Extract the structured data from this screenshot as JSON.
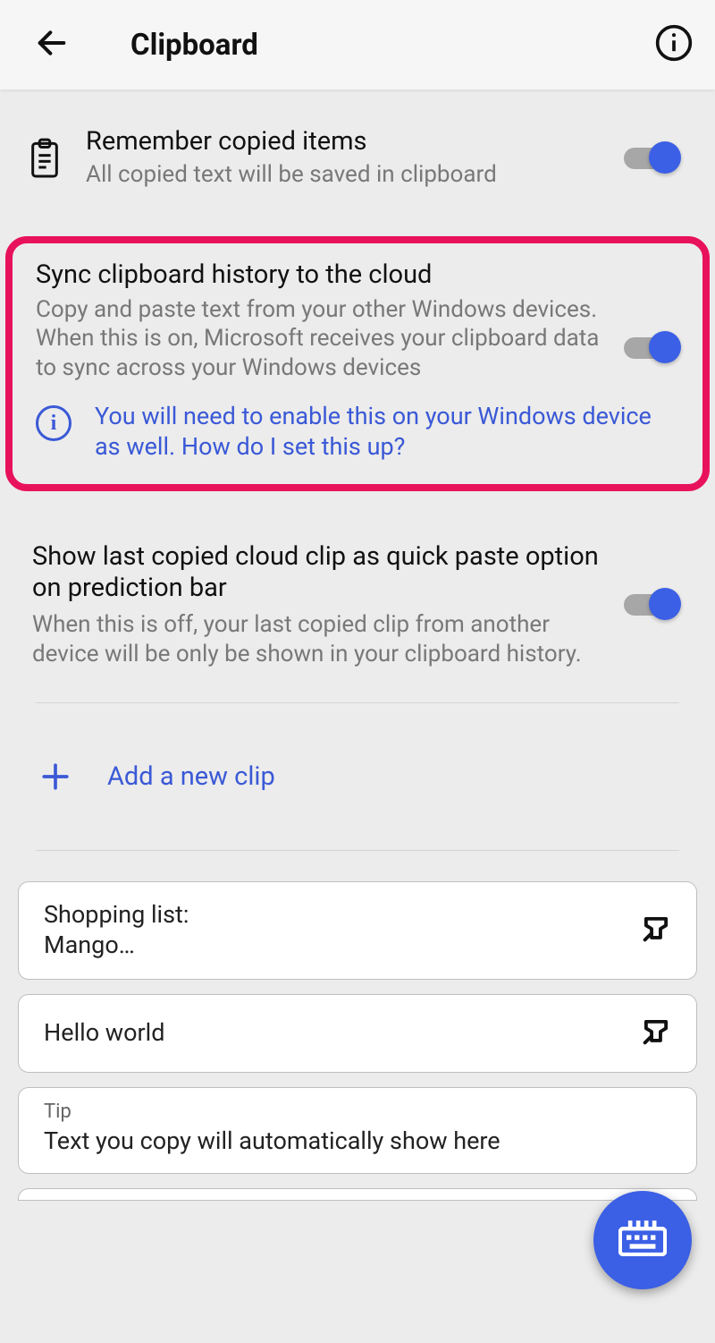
{
  "header": {
    "title": "Clipboard"
  },
  "colors": {
    "accent": "#3b5fe5",
    "highlight_border": "#e8125c",
    "link": "#3a59d6"
  },
  "settings": {
    "remember": {
      "title": "Remember copied items",
      "subtitle": "All copied text will be saved in clipboard",
      "enabled": true
    },
    "sync": {
      "title": "Sync clipboard history to the cloud",
      "subtitle": "Copy and paste text from your other Windows devices. When this is on, Microsoft receives your clipboard data to sync across your Windows devices",
      "info_link": "You will need to enable this on your Windows device as well. How do I set this up?",
      "enabled": true
    },
    "show_last": {
      "title": "Show last copied cloud clip as quick paste option on prediction bar",
      "subtitle": "When this is off, your last copied clip from another device will be only be shown in your clipboard history.",
      "enabled": true
    }
  },
  "add_clip": {
    "label": "Add a new clip"
  },
  "clips": [
    {
      "text": "Shopping list:\nMango…",
      "pinned": true
    },
    {
      "text": "Hello world",
      "pinned": true
    }
  ],
  "tip": {
    "label": "Tip",
    "text": "Text you copy will automatically show here"
  }
}
